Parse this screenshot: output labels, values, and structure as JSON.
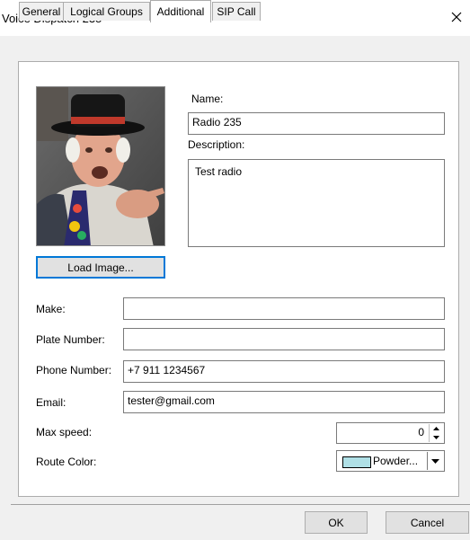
{
  "window": {
    "title": "Voice Dispatch 235"
  },
  "tabs": [
    {
      "label": "General"
    },
    {
      "label": "Logical Groups"
    },
    {
      "label": "Additional"
    },
    {
      "label": "SIP Call"
    }
  ],
  "active_tab": "Additional",
  "photo": {
    "load_button_label": "Load Image..."
  },
  "form": {
    "name_label": "Name:",
    "name_value": "Radio 235",
    "description_label": "Description:",
    "description_value": "Test radio",
    "make_label": "Make:",
    "make_value": "",
    "plate_label": "Plate Number:",
    "plate_value": "",
    "phone_label": "Phone Number:",
    "phone_value": "+7 911 1234567",
    "email_label": "Email:",
    "email_value": "tester@gmail.com",
    "max_speed_label": "Max speed:",
    "max_speed_value": "0",
    "route_color_label": "Route Color:",
    "route_color_value": "Powder...",
    "route_color_swatch": "#b0e0e6"
  },
  "footer": {
    "ok_label": "OK",
    "cancel_label": "Cancel"
  }
}
